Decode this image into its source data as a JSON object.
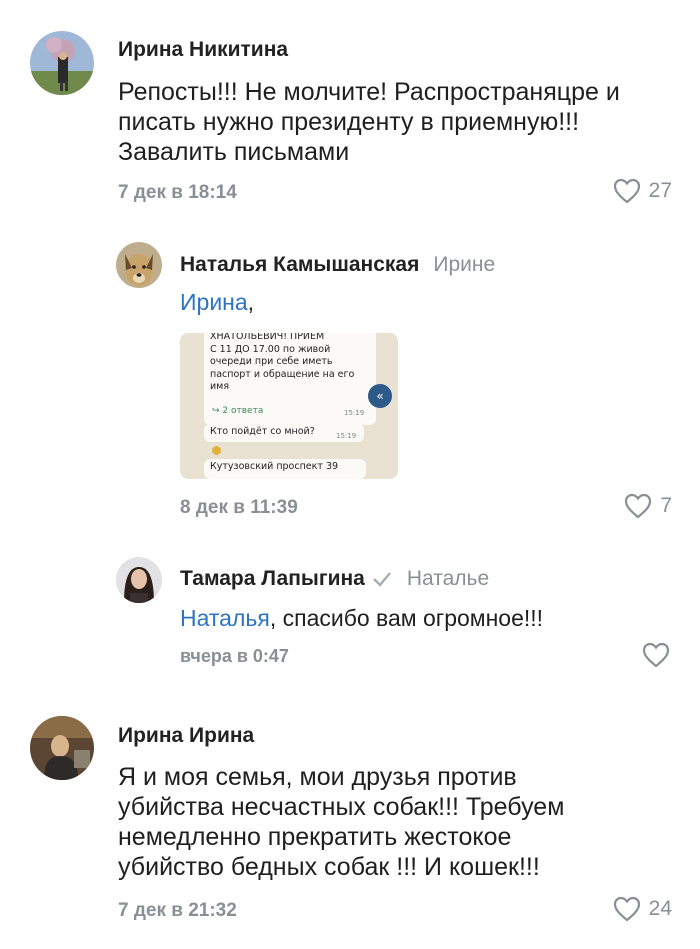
{
  "comments": [
    {
      "author": "Ирина Никитина",
      "text_lines": [
        "Репосты!!! Не молчите! Распространяцре и",
        "писать нужно президенту в приемную!!!",
        "Завалить письмами"
      ],
      "date": "7 дек в 18:14",
      "likes": "27"
    },
    {
      "author": "Наталья Камышанская",
      "reply_to": "Ирине",
      "mention": "Ирина",
      "mention_suffix": ",",
      "attachment": {
        "lines": [
          "ХНАТОЛЬЕВИЧ! ПРИЕМ",
          "С 11 ДО 17.00 по живой",
          "очереди при себе иметь",
          "паспорт и обращение на его",
          "имя"
        ],
        "replies": "↪ 2 ответа",
        "time1": "15:19",
        "question": "Кто пойдёт со мной?",
        "time2": "15:19",
        "address": "Кутузовский проспект 39",
        "scroll_glyph": "«"
      },
      "date": "8 дек в 11:39",
      "likes": "7"
    },
    {
      "author": "Тамара Лапыгина",
      "reply_to": "Наталье",
      "mention": "Наталья",
      "text_rest": ", спасибо вам огромное!!!",
      "date": "вчера в 0:47",
      "likes": ""
    },
    {
      "author": "Ирина Ирина",
      "text_lines": [
        "Я и моя семья, мои друзья против",
        "убийства несчастных собак!!! Требуем",
        "немедленно прекратить жестокое",
        "убийство бедных собак !!! И кошек!!!"
      ],
      "date": "7 дек в 21:32",
      "likes": "24"
    }
  ]
}
